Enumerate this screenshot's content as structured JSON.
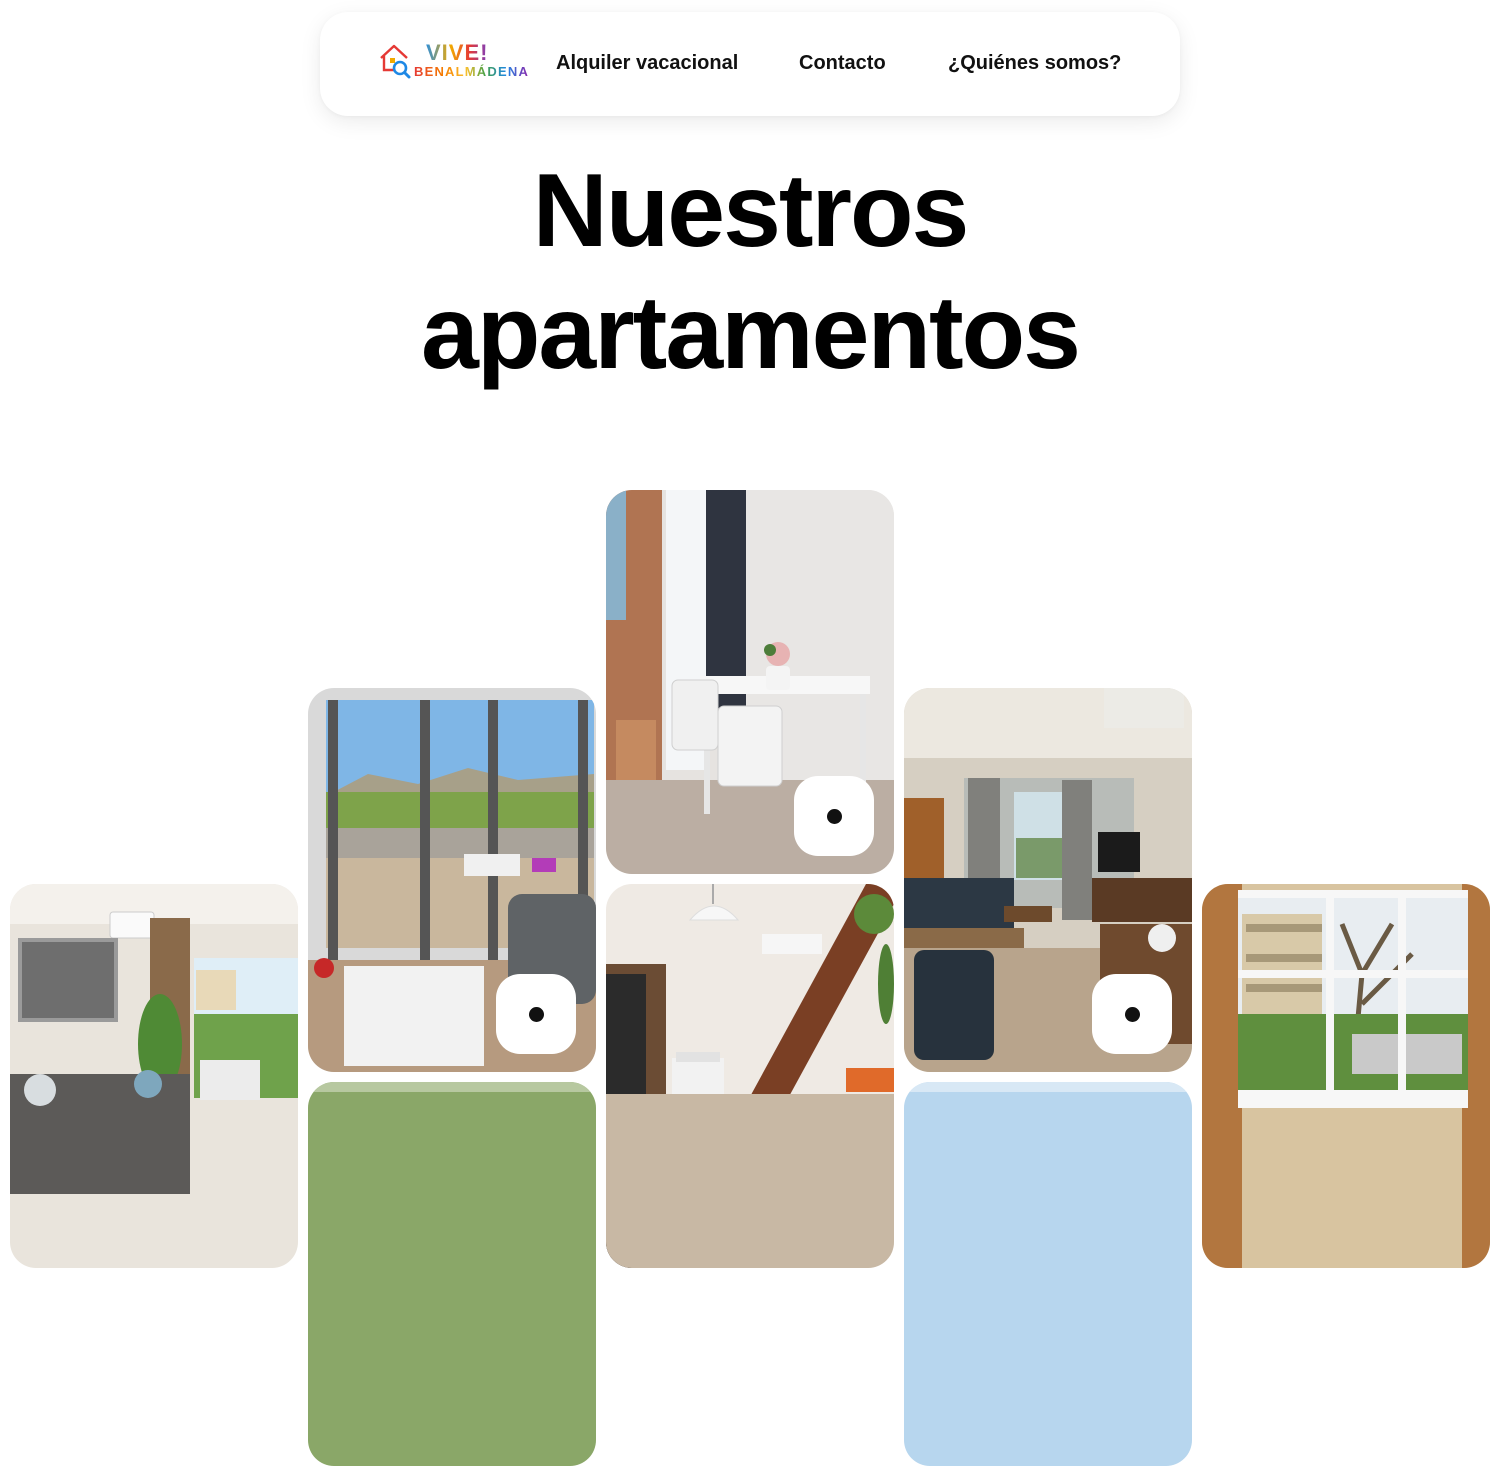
{
  "brand": {
    "line1": "VIVE!",
    "line2": "BENALMÁDENA",
    "line1_colors": [
      "#2e8fd8",
      "#f2a900",
      "#e53935",
      "#7b3fbf",
      "#2e8fd8"
    ],
    "line2_colors": [
      "#e53935",
      "#f57c00",
      "#fbc02d",
      "#43a047",
      "#1e88e5",
      "#8e24aa"
    ]
  },
  "nav": {
    "items": [
      {
        "label": "Alquiler vacacional"
      },
      {
        "label": "Contacto"
      },
      {
        "label": "¿Quiénes somos?"
      }
    ]
  },
  "hero": {
    "title_line1": "Nuestros",
    "title_line2": "apartamentos"
  },
  "gallery": {
    "cards": [
      {
        "name": "apartment-card-living-room-bright"
      },
      {
        "name": "apartment-card-balcony-mountain-view"
      },
      {
        "name": "apartment-card-dining-white-chairs"
      },
      {
        "name": "apartment-card-living-room-dark-sofa"
      },
      {
        "name": "apartment-card-window-tree-view"
      },
      {
        "name": "apartment-card-hallway-stairs"
      },
      {
        "name": "apartment-card-partial-green"
      },
      {
        "name": "apartment-card-partial-sky"
      }
    ],
    "play_icon": "play-dot-icon"
  }
}
